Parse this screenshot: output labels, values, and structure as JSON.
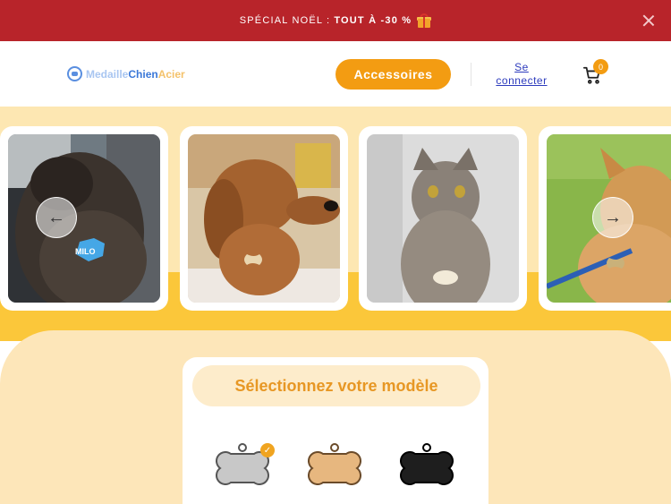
{
  "promo": {
    "prefix": "SPÉCIAL NOËL :",
    "highlight": "TOUT À -30 %"
  },
  "header": {
    "logo": {
      "part1": "Medaille",
      "part2": "Chien",
      "part3": "Acier"
    },
    "accessories_label": "Accessoires",
    "login_label": "Se connecter",
    "cart_count": "0"
  },
  "gallery": {
    "photos": [
      {
        "subject": "dog with blue bone tag",
        "tag_text": "MILO"
      },
      {
        "subject": "dachshund with bone tag"
      },
      {
        "subject": "tabby cat with tag"
      },
      {
        "subject": "dog with bone tag on leash"
      }
    ]
  },
  "selector": {
    "title": "Sélectionnez votre modèle",
    "models": [
      {
        "name": "silver",
        "color": "#c8c8c8",
        "selected": true
      },
      {
        "name": "gold",
        "color": "#e7b77f",
        "selected": false
      },
      {
        "name": "black",
        "color": "#1e1e1e",
        "selected": false
      }
    ]
  },
  "colors": {
    "promo_bg": "#b8242a",
    "accent": "#f39c12",
    "gallery_bg": "#fde7b2"
  }
}
